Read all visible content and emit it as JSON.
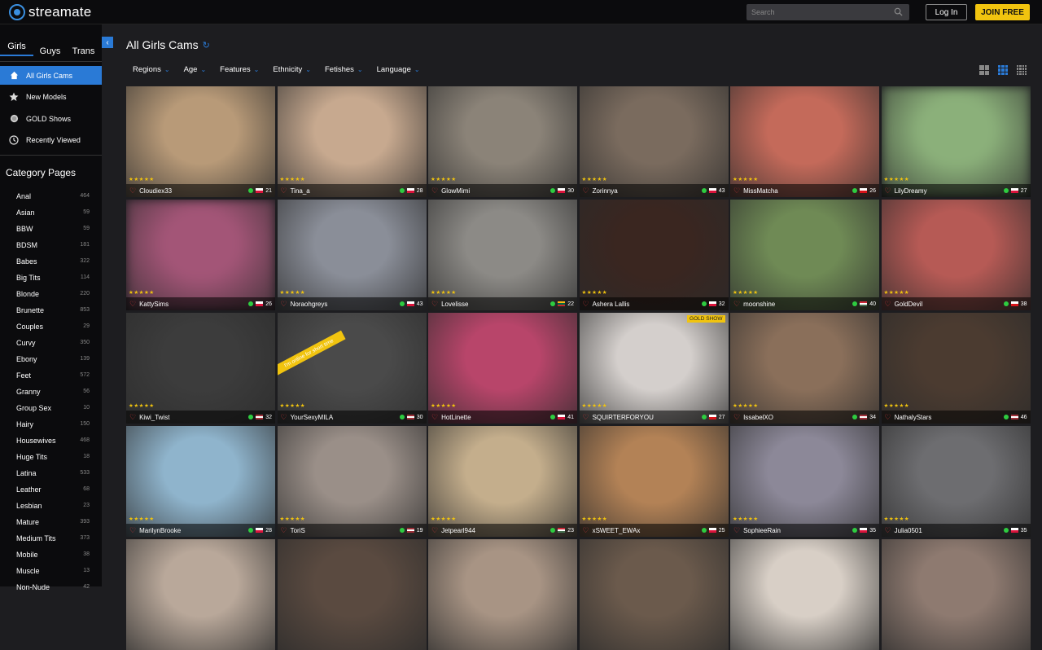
{
  "header": {
    "logo_text": "streamate",
    "search_placeholder": "Search",
    "login_label": "Log In",
    "join_label": "JOIN FREE"
  },
  "gender_tabs": [
    "Girls",
    "Guys",
    "Trans"
  ],
  "nav": [
    {
      "label": "All Girls Cams",
      "icon": "home-icon"
    },
    {
      "label": "New Models",
      "icon": "star-icon"
    },
    {
      "label": "GOLD Shows",
      "icon": "coin-icon"
    },
    {
      "label": "Recently Viewed",
      "icon": "clock-icon"
    }
  ],
  "category_title": "Category Pages",
  "categories": [
    {
      "name": "Anal",
      "count": "464"
    },
    {
      "name": "Asian",
      "count": "59"
    },
    {
      "name": "BBW",
      "count": "59"
    },
    {
      "name": "BDSM",
      "count": "181"
    },
    {
      "name": "Babes",
      "count": "322"
    },
    {
      "name": "Big Tits",
      "count": "114"
    },
    {
      "name": "Blonde",
      "count": "220"
    },
    {
      "name": "Brunette",
      "count": "853"
    },
    {
      "name": "Couples",
      "count": "29"
    },
    {
      "name": "Curvy",
      "count": "350"
    },
    {
      "name": "Ebony",
      "count": "139"
    },
    {
      "name": "Feet",
      "count": "572"
    },
    {
      "name": "Granny",
      "count": "56"
    },
    {
      "name": "Group Sex",
      "count": "10"
    },
    {
      "name": "Hairy",
      "count": "150"
    },
    {
      "name": "Housewives",
      "count": "468"
    },
    {
      "name": "Huge Tits",
      "count": "18"
    },
    {
      "name": "Latina",
      "count": "533"
    },
    {
      "name": "Leather",
      "count": "68"
    },
    {
      "name": "Lesbian",
      "count": "23"
    },
    {
      "name": "Mature",
      "count": "393"
    },
    {
      "name": "Medium Tits",
      "count": "373"
    },
    {
      "name": "Mobile",
      "count": "38"
    },
    {
      "name": "Muscle",
      "count": "13"
    },
    {
      "name": "Non-Nude",
      "count": "42"
    }
  ],
  "page_title": "All Girls Cams",
  "filters": [
    "Regions",
    "Age",
    "Features",
    "Ethnicity",
    "Fetishes",
    "Language"
  ],
  "cards": [
    {
      "name": "Cloudiex33",
      "num": "21",
      "bg": "#b89a78",
      "flag": "pl"
    },
    {
      "name": "Tina_a",
      "num": "28",
      "bg": "#c7a98f",
      "flag": "pl"
    },
    {
      "name": "GlowMimi",
      "num": "30",
      "bg": "#8b8378",
      "flag": "pl"
    },
    {
      "name": "Zorinnya",
      "num": "43",
      "bg": "#7a6b5e",
      "flag": "pl"
    },
    {
      "name": "MissMatcha",
      "num": "26",
      "bg": "#c46a5a",
      "flag": "cz"
    },
    {
      "name": "LilyDreamy",
      "num": "27",
      "bg": "#8bb07a",
      "flag": "pl",
      "blur": true
    },
    {
      "name": "KattySims",
      "num": "26",
      "bg": "#a35577",
      "flag": "pl",
      "blur": true
    },
    {
      "name": "Noraohgreys",
      "num": "43",
      "bg": "#8a8e98",
      "flag": "pl"
    },
    {
      "name": "Lovelisse",
      "num": "22",
      "bg": "#8c8a86",
      "flag": "lt"
    },
    {
      "name": "Ashera Lallis",
      "num": "32",
      "bg": "#3a2620",
      "flag": "pl"
    },
    {
      "name": "moonshine",
      "num": "40",
      "bg": "#6f8a55",
      "flag": "hu"
    },
    {
      "name": "GoldDevil",
      "num": "38",
      "bg": "#b65a55",
      "flag": "cz"
    },
    {
      "name": "Kiwi_Twist",
      "num": "32",
      "bg": "#3c3c3c",
      "flag": "lv"
    },
    {
      "name": "YourSexyMILA",
      "num": "30",
      "bg": "#4a4a4a",
      "flag": "lv",
      "ribbon": "I'm online for short time"
    },
    {
      "name": "HotLinette",
      "num": "41",
      "bg": "#b8456a",
      "flag": "pl"
    },
    {
      "name": "SQUIRTERFORYOU",
      "num": "27",
      "bg": "#d4cfcc",
      "flag": "cz",
      "gold": "GOLD SHOW"
    },
    {
      "name": "IssabelXO",
      "num": "34",
      "bg": "#8a6f5a",
      "flag": "lv"
    },
    {
      "name": "NathalyStars",
      "num": "46",
      "bg": "#4b3b30",
      "flag": "lv"
    },
    {
      "name": "MarilynBrooke",
      "num": "28",
      "bg": "#8fb4cc",
      "flag": "pl"
    },
    {
      "name": "ToriS",
      "num": "19",
      "bg": "#9a8f88",
      "flag": "lv"
    },
    {
      "name": "Jetpearl944",
      "num": "23",
      "bg": "#c4ae8c",
      "flag": "hu"
    },
    {
      "name": "xSWEET_EWAx",
      "num": "25",
      "bg": "#b38256",
      "flag": "pl"
    },
    {
      "name": "SophieeRain",
      "num": "35",
      "bg": "#8c8898",
      "flag": "pl"
    },
    {
      "name": "Julia0501",
      "num": "35",
      "bg": "#6d6d70",
      "flag": "pl"
    },
    {
      "name": "",
      "num": "",
      "bg": "#b9a89a",
      "flag": ""
    },
    {
      "name": "",
      "num": "",
      "bg": "#5a4a40",
      "flag": ""
    },
    {
      "name": "",
      "num": "",
      "bg": "#a89484",
      "flag": ""
    },
    {
      "name": "",
      "num": "",
      "bg": "#6b5a4c",
      "flag": ""
    },
    {
      "name": "",
      "num": "",
      "bg": "#d8cfc6",
      "flag": ""
    },
    {
      "name": "",
      "num": "",
      "bg": "#8e7a70",
      "flag": ""
    }
  ],
  "colors": {
    "accent": "#2a7ad6",
    "join": "#f1c40f"
  }
}
